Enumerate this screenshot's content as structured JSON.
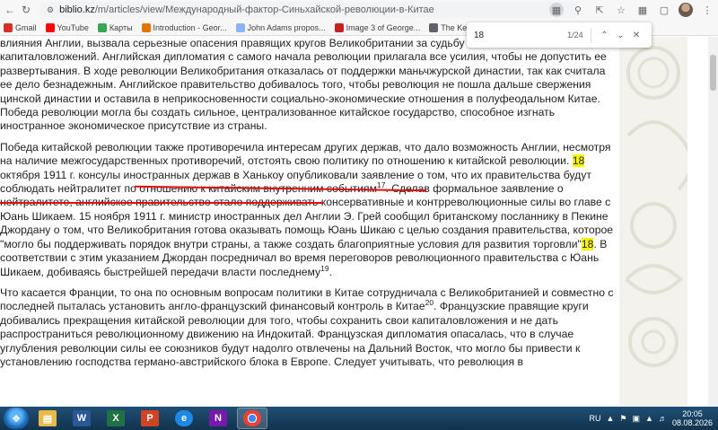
{
  "browser": {
    "url_domain": "biblio.kz",
    "url_path": "/m/articles/view/Международный-фактор-Синьхайской-революции-в-Китае",
    "bookmarks": [
      {
        "label": "Gmail",
        "color": "#d93025"
      },
      {
        "label": "YouTube",
        "color": "#ff0000"
      },
      {
        "label": "Карты",
        "color": "#34a853"
      },
      {
        "label": "Introduction - Geor...",
        "color": "#e37400"
      },
      {
        "label": "John Adams propos...",
        "color": "#8ab4f8"
      },
      {
        "label": "Image 3 of George...",
        "color": "#c5221f"
      },
      {
        "label": "The Kennedy-Mac...",
        "color": "#5f6368"
      }
    ]
  },
  "find": {
    "query": "18",
    "count": "1/24"
  },
  "article": {
    "p1": "влияния Англии, вызвала серьезные опасения правящих кругов Великобритании за судьбу английских капиталовложений. Английская дипломатия с самого начала революции прилагала все усилия, чтобы не допустить ее развертывания. В ходе революции Великобритания отказалась от поддержки маньчжурской династии, так как считала ее дело безнадежным. Английское правительство добивалось того, чтобы революция не пошла дальше свержения цинской династии и оставила в неприкосновенности социально-экономические отношения в полуфеодальном Китае. Победа революции могла бы создать сильное, централизованное китайское государство, способное изгнать иностранное экономическое присутствие из страны.",
    "p2_a": "Победа китайской революции также противоречила интересам других держав, что дало возможность Англии, несмотря на наличие межгосударственных противоречий, отстоять свою политику по отношению к китайской революции. ",
    "p2_hl1": "18",
    "p2_b": " октября 1911 г. консулы иностранных держав в Ханькоу опубликовали заявление о том, что их правительства будут соблюдать нейтралитет по отношению к китайским внутренним событиям",
    "p2_sup1": "17",
    "p2_c": ". Сделав формальное заявление о нейтралитете, английское правительство стало поддерживать консервативные и контрреволюционные силы во главе с Юань Шикаем. 15 ноября 1911 г. министр иностранных дел Англии Э. Грей сообщил британскому посланнику в Пекине Джордану о том, что Великобритания готова оказывать помощь Юань Шикаю с целью создания правительства, которое \"могло бы поддерживать порядок внутри страны, а также создать благоприятные условия для развития торговли\"",
    "p2_hl2": "18",
    "p2_d": ". В соответствии с этим указанием Джордан посредничал во время переговоров революционного правительства с Юань Шикаем, добиваясь быстрейшей передачи власти последнему",
    "p2_sup2": "19",
    "p2_e": ".",
    "p3_a": "Что касается Франции, то она по основным вопросам политики в Китае сотрудничала с Великобританией и совместно с последней пыталась установить англо-французский финансовый контроль в Китае",
    "p3_sup": "20",
    "p3_b": ". Французские правящие круги добивались прекращения китайской революции для того, чтобы сохранить свои капиталовложения и не дать распространиться революционному движению на Индокитай. Французская дипломатия опасалась, что в случае углубления революции силы ее союзников будут надолго отвлечены на Дальний Восток, что могло бы привести к установлению господства германо-австрийского блока в Европе. Следует учитывать, что революция в"
  },
  "taskbar": {
    "lang": "RU",
    "time": "20:05",
    "date": "08.08.2026"
  }
}
